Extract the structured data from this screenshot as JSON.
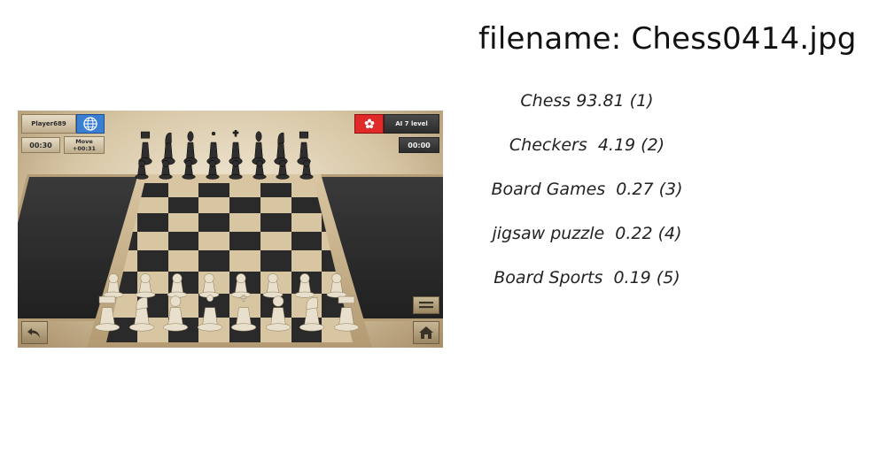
{
  "filename_label": "filename: Chess0414.jpg",
  "predictions": [
    {
      "label": "Chess 93.81 (1)"
    },
    {
      "label": "Checkers  4.19 (2)"
    },
    {
      "label": "Board Games  0.27 (3)"
    },
    {
      "label": "jigsaw puzzle  0.22 (4)"
    },
    {
      "label": "Board Sports  0.19 (5)"
    }
  ],
  "game": {
    "player_name": "Player689",
    "player_timer": "00:30",
    "move_label": "Move",
    "move_timer": "+00:31",
    "ai_label": "AI 7 level",
    "ai_timer": "00:00",
    "icons": {
      "player_flag": "globe-icon",
      "ai_flag": "hong-kong-flag-icon",
      "undo": "undo-arrow-icon",
      "menu": "menu-icon",
      "home": "home-icon"
    },
    "colors": {
      "light_square": "#d8c6a3",
      "dark_square": "#2a2a2a",
      "white_pieces": "#e8e0cc",
      "black_pieces": "#2e2e2e"
    }
  }
}
